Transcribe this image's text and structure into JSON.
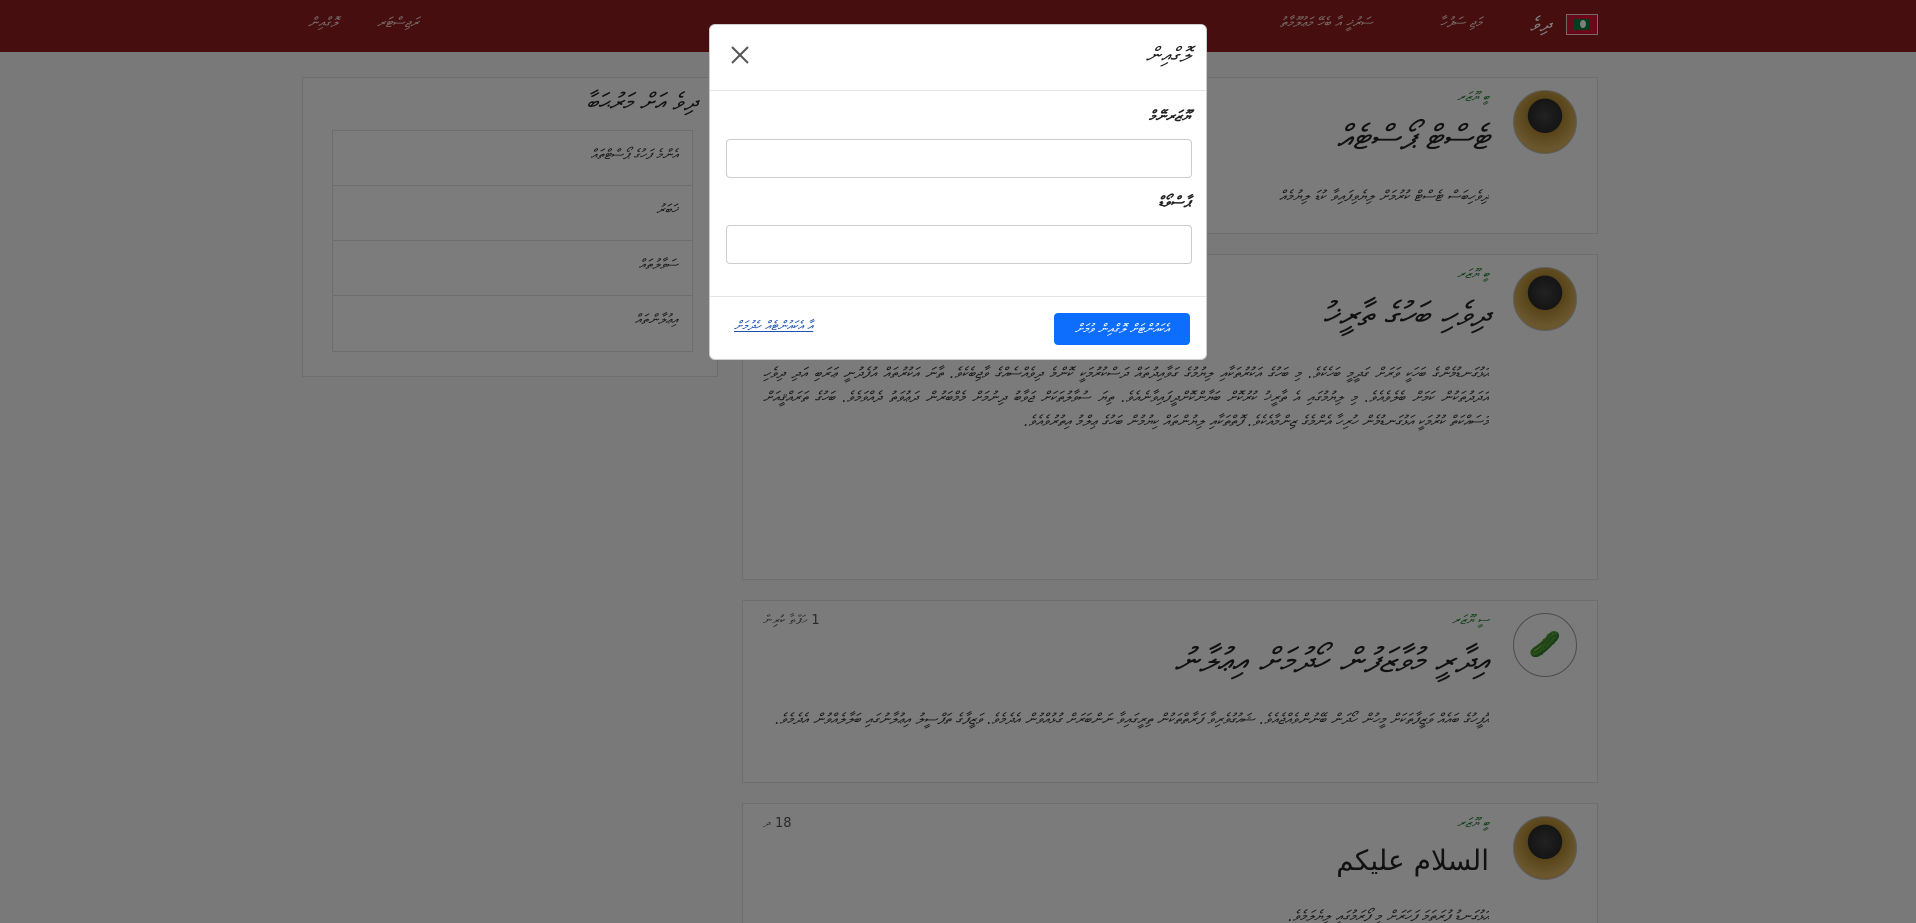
{
  "header": {
    "brand": "ދިވެ",
    "nav_right": [
      "މަޖި ސަފުހާ",
      "ސަރުޚީ އާ ބެހޭ މަޢުލޫމާތު"
    ],
    "nav_left": [
      "ރަޖިސްޓަރ",
      "ލޮގްއިން"
    ]
  },
  "sidebar": {
    "title": "ދިވެ އަށް މަރުޙަބާ",
    "items": [
      "އެންމެ ފަހުގެ ޕޯސްޓްތައް",
      "ޚަބަރު",
      "ސަވާލުތައް",
      "އިޢުލާންތައް"
    ]
  },
  "posts": [
    {
      "user": "ބީ ޔޫޒަރ",
      "meta": "",
      "title": "ޓެސްޓް ޕޯސްޓެއް",
      "body": "ދިވެހިބަސް ޓެސްޓް ކުރުމަށް ލިޔެވިފައިވާ ކުޑަ ލިޔުމެއް"
    },
    {
      "user": "ބީ ޔޫޒަރ",
      "meta": "",
      "title": "ދިވެހި ބަހުގެ ތާރީޚު",
      "body": "އަޅުގަނޑުމެންގެ ބަހަކީ ވަރަށް ގަދީމީ ބަހެކެވެ. މި ބަހުގެ އަކުރުތަކާއި ލިޔުމުގެ ގަވާއިދުތައް ދަސްކުރުމަކީ ކޮންމެ ދިވެއްސެއްގެ ވާޖިބެކެވެ. ތާނަ އަކުރުތައް އުފެދުނީ ޢަރަބި އަދި ދިވެހި އަދަދުތަކުން ކަމަށް ބެލެވެއެވެ. މި ލިޔުމުގައި އެ ތާރީޚު ކުރުކޮށް ބަޔާންކޮށްދީފައިވާނެއެވެ. ތިޔަ ސުވާލުތަކަށް ޖަވާބު ދިނުމަށް މެމްބަރުން ދަޢުވަތު ދެއްވަމެވެ. ބަހުގެ ތަރައްޤީއަށް މަސައްކަތް ކުރުމަކީ އަޅުގަނޑުމެން ހުރިހާ އެންމެގެ ޒިންމާއެކެވެ. ފޮތްތަކާއި ލިޔުންތައް ކިޔުމުން ބަހުގެ ޢިލްމު އިތުރުވެއެވެ."
    },
    {
      "user": "ސީ ޔޫޒަރ",
      "meta": "1 ހަފްތާ ކުރިން",
      "title": "އިދާރީ މުވާޒަފުން ހޯދުމަށް އިޢުލާނު",
      "body": "އޮފީހުގެ ބައެއް ވަޒީފާތަކަށް މީހުން ހޯދަން ބޭނުންވެއްޖެއެވެ. ޝައުގުވެރިވާ ފަރާތްތަކުން ތިރީގައިވާ ނަންބަރަށް ގުޅުއްވުން އެދެމެވެ. ވަޒީފާގެ ތަފްސީލު އިޢުލާނުގައި ބަލާލެއްވުން އެދެމެވެ."
    },
    {
      "user": "ބީ ޔޫޒަރ",
      "meta": "18 ދ",
      "title": "السلام عليكم",
      "body": "އަޅުގަނޑު ފުރަތަމަ ފަހަރަށް މި ފޯރަމުގައި ލިޔެލަމެވެ."
    }
  ],
  "modal": {
    "title": "ލޮގްއިން",
    "username_label": "ޔޫޒަރނޭމް",
    "username_value": "",
    "password_label": "ޕާސްވޯޑް",
    "password_value": "",
    "login_button": "އެކައުންޓަށް ލޮގްއިން ވުމަށް",
    "register_link": "އާ އެކައުންޓެއް ހެދުމަށް"
  }
}
